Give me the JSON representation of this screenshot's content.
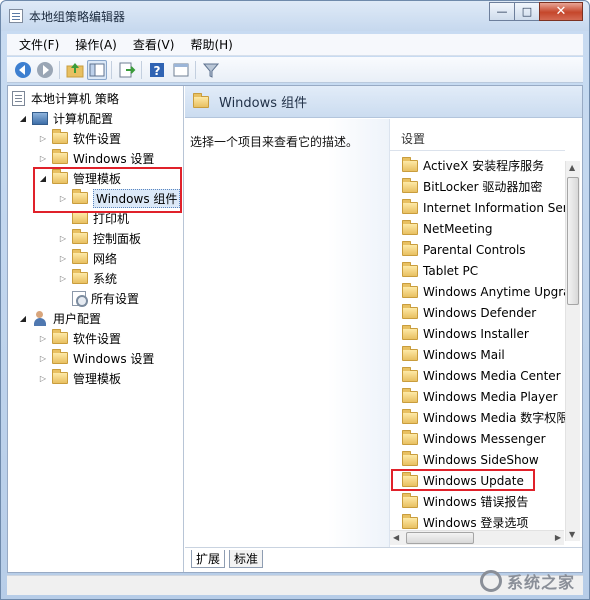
{
  "window": {
    "title": "本地组策略编辑器",
    "controls": {
      "minimize": "—",
      "maximize": "□",
      "close": "✕"
    }
  },
  "menu": [
    "文件(F)",
    "操作(A)",
    "查看(V)",
    "帮助(H)"
  ],
  "toolbar_icons": [
    "back-arrow-icon",
    "forward-arrow-icon",
    "up-folder-icon",
    "show-hide-tree-icon",
    "export-list-icon",
    "help-icon",
    "properties-icon",
    "filter-icon"
  ],
  "tree": {
    "root": "本地计算机 策略",
    "computer_config": "计算机配置",
    "cc_software": "软件设置",
    "cc_windows": "Windows 设置",
    "cc_admin": "管理模板",
    "cc_admin_windows_components": "Windows 组件",
    "cc_admin_printers": "打印机",
    "cc_admin_control_panel": "控制面板",
    "cc_admin_network": "网络",
    "cc_admin_system": "系统",
    "cc_admin_all_settings": "所有设置",
    "user_config": "用户配置",
    "uc_software": "软件设置",
    "uc_windows": "Windows 设置",
    "uc_admin": "管理模板"
  },
  "right": {
    "header_title": "Windows 组件",
    "description": "选择一个项目来查看它的描述。",
    "list_header": "设置",
    "items": [
      "ActiveX 安装程序服务",
      "BitLocker 驱动器加密",
      "Internet Information Serv",
      "NetMeeting",
      "Parental Controls",
      "Tablet PC",
      "Windows Anytime Upgrad",
      "Windows Defender",
      "Windows Installer",
      "Windows Mail",
      "Windows Media Center",
      "Windows Media Player",
      "Windows Media 数字权限",
      "Windows Messenger",
      "Windows SideShow",
      "Windows Update",
      "Windows 错误报告",
      "Windows 登录选项"
    ]
  },
  "tabs": [
    "扩展",
    "标准"
  ],
  "watermark": "系统之家",
  "colors": {
    "highlight_box": "#e0212a",
    "header_blue": "#cbdcf0"
  }
}
